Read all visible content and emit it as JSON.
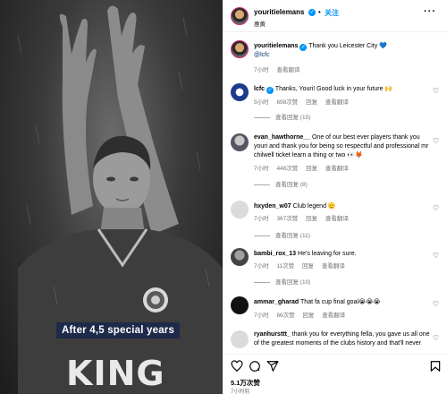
{
  "media": {
    "caption": "After 4,5 special years",
    "shirt_text": "KING"
  },
  "header": {
    "username": "youritielemans",
    "dot": "•",
    "follow_label": "关注",
    "location": "惠黄",
    "more": "···"
  },
  "post": {
    "username": "youritielemans",
    "text": "Thank you Leicester City 💙",
    "tag": "@lcfc",
    "time": "7小时",
    "translate": "查看翻译"
  },
  "comments": [
    {
      "username": "lcfc",
      "verified": true,
      "text": "Thanks, Youri! Good luck in your future 🙌",
      "time": "5小时",
      "likes": "698次赞",
      "reply": "回复",
      "translate": "查看翻译",
      "replies": "查看回复 (15)"
    },
    {
      "username": "evan_hawthorne__",
      "verified": false,
      "text": "One of our best ever players thank you youri and thank you for being so respectful and professional mr chilwell ticket learn a thing or two 👀🦊",
      "time": "7小时",
      "likes": "448次赞",
      "reply": "回复",
      "translate": "查看翻译",
      "replies": "查看回复 (8)"
    },
    {
      "username": "hxyden_w07",
      "verified": false,
      "text": "Club legend 🫡",
      "time": "7小时",
      "likes": "367次赞",
      "reply": "回复",
      "translate": "查看翻译",
      "replies": "查看回复 (11)"
    },
    {
      "username": "bambi_rox_13",
      "verified": false,
      "text": "He's leaving for sure.",
      "time": "7小时",
      "likes": "11次赞",
      "reply": "回复",
      "translate": "查看翻译",
      "replies": "查看回复 (10)"
    },
    {
      "username": "ammar_gharad",
      "verified": false,
      "text": "That fa cup final goal😭😭😭",
      "time": "7小时",
      "likes": "66次赞",
      "reply": "回复",
      "translate": "查看翻译",
      "replies": ""
    },
    {
      "username": "ryanhursttt_",
      "verified": false,
      "text": "thank you for everything fella, you gave us all one of the greatest moments of the clubs history and that'll never",
      "time": "",
      "likes": "",
      "reply": "",
      "translate": "",
      "replies": ""
    }
  ],
  "footer": {
    "likes": "5.1万次赞",
    "time": "7小时前"
  },
  "colors": {
    "link": "#0095f6",
    "verified": "#0095f6",
    "muted": "#737373",
    "caption_bg": "#1e2a4a"
  },
  "icons": [
    "more-icon",
    "heart-icon",
    "comment-icon",
    "share-icon",
    "bookmark-icon",
    "verified-icon"
  ]
}
